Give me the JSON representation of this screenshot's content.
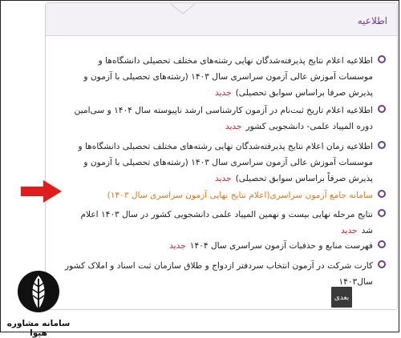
{
  "panel": {
    "title": "اطلاعیه"
  },
  "items": [
    {
      "text": "اطلاعیه اعلام نتایج پذیرفته‌شدگان نهایی رشته‌های مختلف تحصیلی دانشگاه‌ها و موسسات آموزش عالی آزمون سراسری سال ۱۴۰۳ (رشته‌های تحصیلی با آزمون و پذیرش صرفا براساس سوابق تحصیلی)",
      "badge": "جدید"
    },
    {
      "text": "اطلاعیه اعلام تاریخ ثبت‌نام در آزمون کارشناسی ارشد ناپیوسته سال ۱۴۰۴ و سی‌امین دوره المپیاد علمی- دانشجویی کشور",
      "badge": "جدید"
    },
    {
      "text": "اطلاعیه زمان اعلام نتایج پذیرفته‌شدگان نهایی رشته‌های مختلف تحصیلی دانشگاه‌ها و موسسات آموزش عالی آزمون سراسری سال ۱۴۰۳ (رشته‌های تحصیلی با آزمون و پذیرش صرفاً براساس سوابق تحصیلی)",
      "badge": "جدید"
    },
    {
      "text": "سامانه جامع آزمون سراسری(اعلام نتایج نهایی آزمون سراسری سال ۱۴۰۳)",
      "badge": ""
    },
    {
      "text": "نتایج مرحله نهایی بیست و نهمین المپیاد علمی دانشجویی کشور در سال ۱۴۰۳ اعلام شد",
      "badge": "جدید"
    },
    {
      "text": "فهرست منابع و حذفیات آزمون سراسری سال ۱۴۰۴",
      "badge": "جدید"
    },
    {
      "text": "کارت شرکت در آزمون انتخاب سردفتر ازدواج و طلاق سازمان ثبت اسناد و املاک کشور سال۱۴۰۳",
      "badge": ""
    }
  ],
  "pagination": {
    "next_label": "بعدی"
  },
  "logo": {
    "text": "سامانه مشاوره هیوا"
  },
  "colors": {
    "accent": "#6b3f8e",
    "highlight": "#e0781e",
    "new_badge": "#d41e1e",
    "arrow": "#e01d1d"
  }
}
